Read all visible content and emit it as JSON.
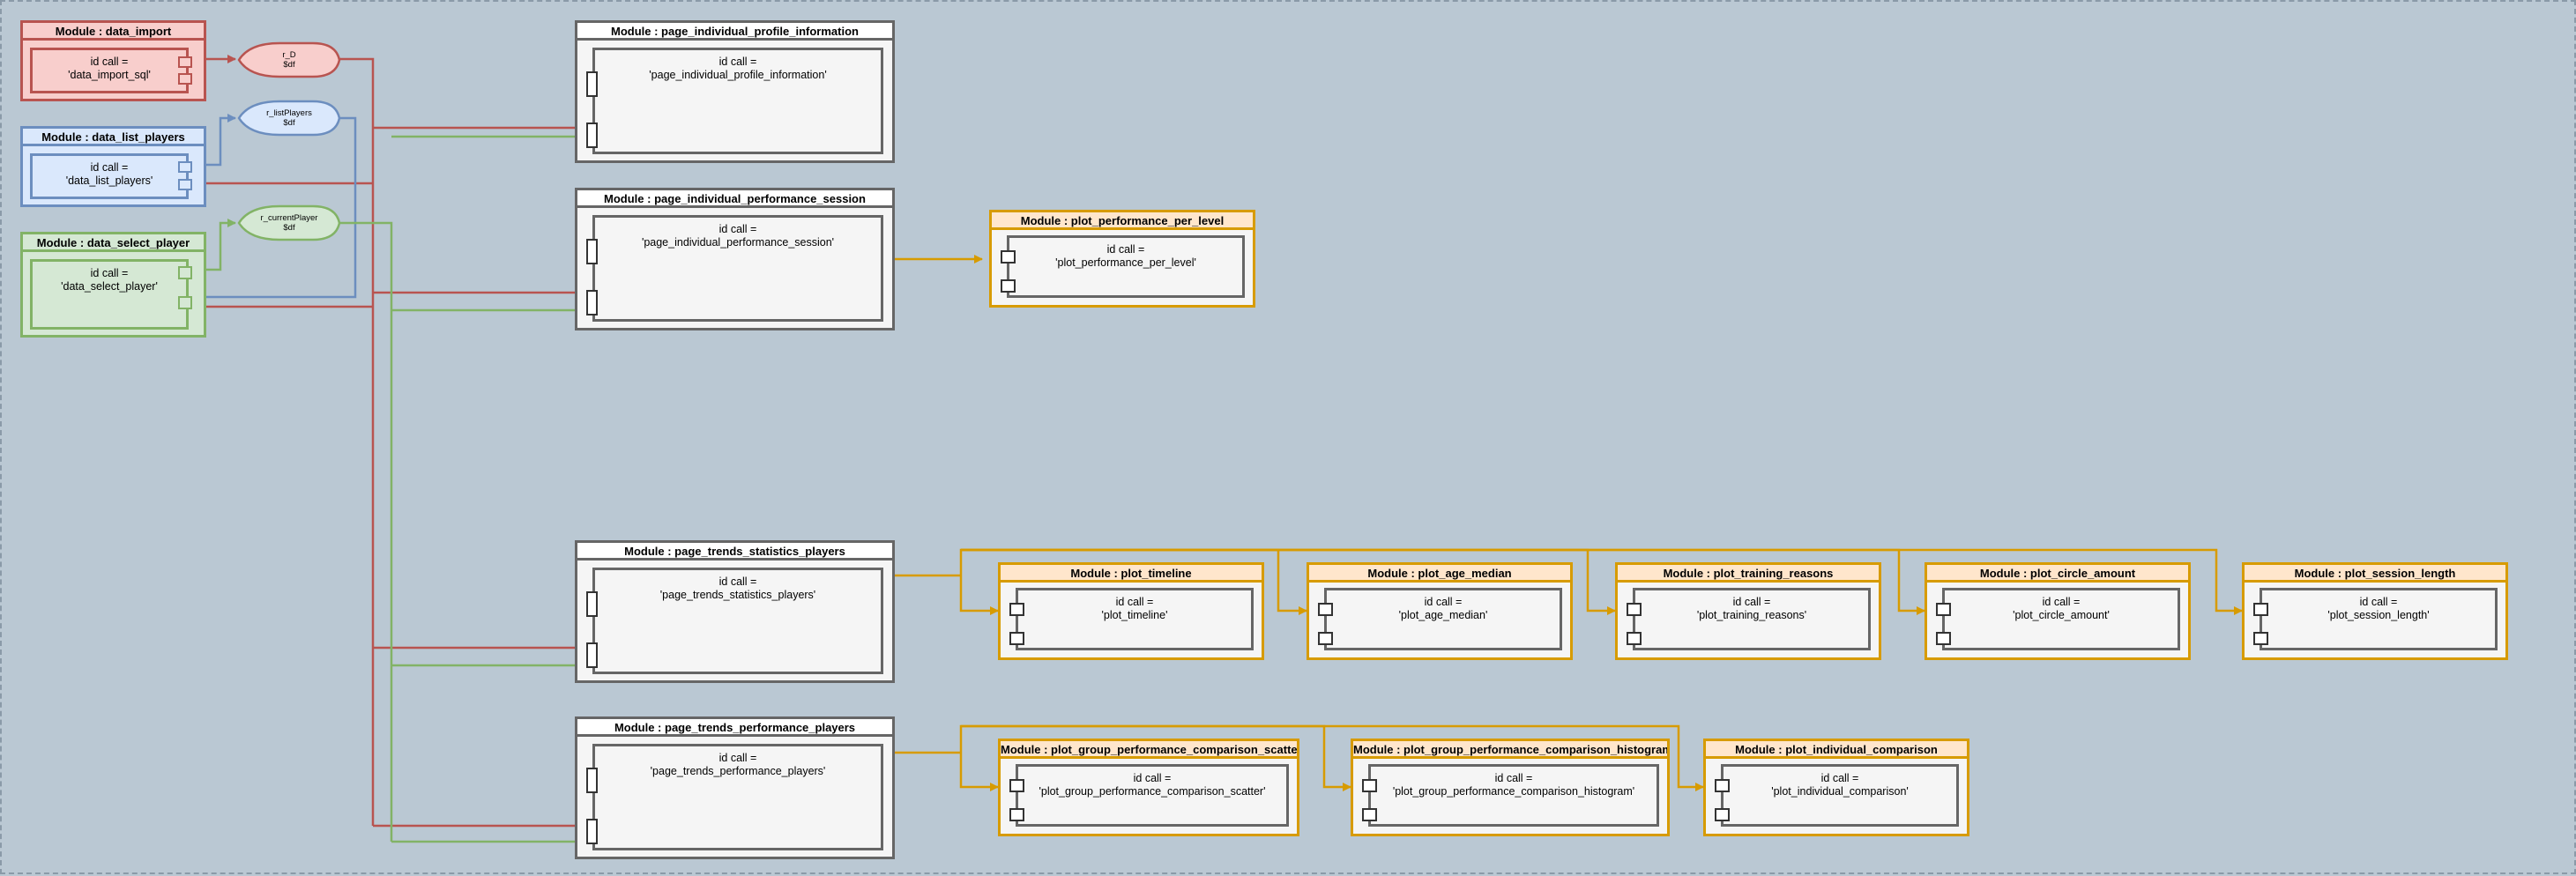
{
  "diagram": {
    "id_call_prefix": "id call =",
    "colors": {
      "red_fill": "#f8cecc",
      "red_stroke": "#b85450",
      "blue_fill": "#dae8fc",
      "blue_stroke": "#6c8ebf",
      "green_fill": "#d5e8d4",
      "green_stroke": "#82b366",
      "orange_fill": "#ffe6cc",
      "orange_stroke": "#d79b00",
      "gray_fill": "#f5f5f5",
      "gray_stroke": "#666666",
      "background": "#bac8d3"
    },
    "data_modules": [
      {
        "title": "Module : data_import",
        "id_call": "'data_import_sql'",
        "color": "red"
      },
      {
        "title": "Module : data_list_players",
        "id_call": "'data_list_players'",
        "color": "blue"
      },
      {
        "title": "Module : data_select_player",
        "id_call": "'data_select_player'",
        "color": "green"
      }
    ],
    "reactives": [
      {
        "name": "r_D",
        "type": "$df",
        "color": "red"
      },
      {
        "name": "r_listPlayers",
        "type": "$df",
        "color": "blue"
      },
      {
        "name": "r_currentPlayer",
        "type": "$df",
        "color": "green"
      }
    ],
    "page_modules": [
      {
        "title": "Module : page_individual_profile_information",
        "id_call": "'page_individual_profile_information'"
      },
      {
        "title": "Module : page_individual_performance_session",
        "id_call": "'page_individual_performance_session'"
      },
      {
        "title": "Module : page_trends_statistics_players",
        "id_call": "'page_trends_statistics_players'"
      },
      {
        "title": "Module : page_trends_performance_players",
        "id_call": "'page_trends_performance_players'"
      }
    ],
    "plot_modules": [
      {
        "title": "Module : plot_performance_per_level",
        "id_call": "'plot_performance_per_level'"
      },
      {
        "title": "Module : plot_timeline",
        "id_call": "'plot_timeline'"
      },
      {
        "title": "Module : plot_age_median",
        "id_call": "'plot_age_median'"
      },
      {
        "title": "Module : plot_training_reasons",
        "id_call": "'plot_training_reasons'"
      },
      {
        "title": "Module : plot_circle_amount",
        "id_call": "'plot_circle_amount'"
      },
      {
        "title": "Module : plot_session_length",
        "id_call": "'plot_session_length'"
      },
      {
        "title": "Module : plot_group_performance_comparison_scatter",
        "id_call": "'plot_group_performance_comparison_scatter'"
      },
      {
        "title": "Module : plot_group_performance_comparison_histogram",
        "id_call": "'plot_group_performance_comparison_histogram'"
      },
      {
        "title": "Module : plot_individual_comparison",
        "id_call": "'plot_individual_comparison'"
      }
    ]
  }
}
